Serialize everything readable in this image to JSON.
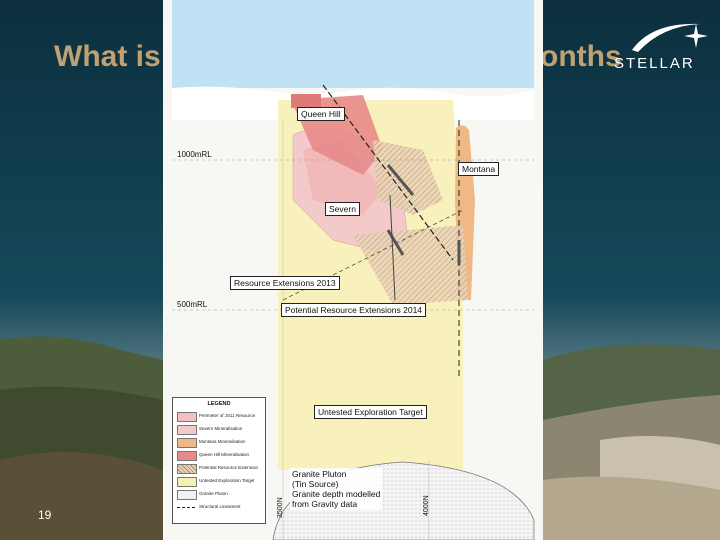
{
  "slide": {
    "title_left": "What is",
    "title_right": "onths",
    "slide_number": "19",
    "brand": "STELLAR"
  },
  "diagram": {
    "levels": {
      "rl_1000": "1000mRL",
      "rl_500": "500mRL"
    },
    "deposits": {
      "queen_hill": "Queen Hill",
      "severn": "Severn",
      "montana": "Montana"
    },
    "callouts": {
      "resource_2013": "Resource Extensions 2013",
      "potential_2014": "Potential Resource Extensions 2014",
      "untested": "Untested Exploration Target"
    },
    "pluton": {
      "line1": "Granite Pluton",
      "line2": "(Tin Source)",
      "line3": "Granite depth modelled",
      "line4": "from Gravity data"
    },
    "northings": {
      "left": "3500N",
      "right": "4000N"
    },
    "legend": {
      "title": "LEGEND",
      "items": [
        {
          "label": "Perimeter of JS11 Resource",
          "color": "#f3c0c0"
        },
        {
          "label": "Severn Mineralisation",
          "color": "#f4c9c9"
        },
        {
          "label": "Montana Mineralisation",
          "color": "#f0b884"
        },
        {
          "label": "Queen Hill Mineralisation",
          "color": "#e88a8a"
        },
        {
          "label": "Potential Resource Extension",
          "color": "#d9b48f"
        },
        {
          "label": "Untested Exploration Target",
          "color": "#f8efb5"
        },
        {
          "label": "Granite Pluton",
          "color": "#f2f2f2"
        },
        {
          "label": "Structural Lineament",
          "color": "#222222"
        }
      ]
    }
  }
}
